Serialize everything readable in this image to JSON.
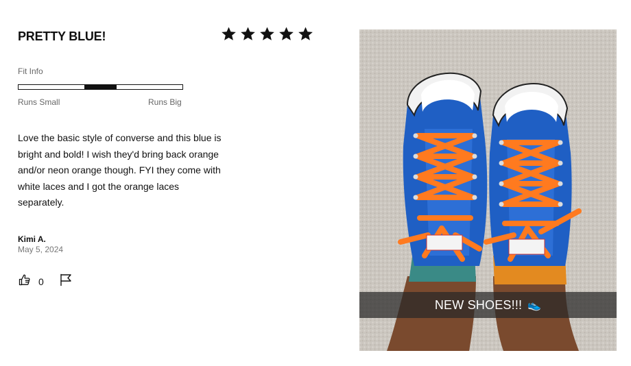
{
  "review": {
    "title": "PRETTY BLUE!",
    "rating": 5,
    "rating_max": 5,
    "fit": {
      "label": "Fit Info",
      "min_label": "Runs Small",
      "max_label": "Runs Big",
      "value": 0.5
    },
    "body": "Love the basic style of converse and this blue is bright and bold! I wish they'd bring back orange and/or neon orange though. FYI they come with white laces and I got the orange laces separately.",
    "author": "Kimi A.",
    "date": "May 5, 2024",
    "helpful_count": "0",
    "icons": {
      "helpful": "thumbs-up-icon",
      "report": "flag-icon",
      "star": "star-icon"
    }
  },
  "photo": {
    "caption": "NEW SHOES!!!",
    "caption_emoji": "👟",
    "colors": {
      "shoe_blue": "#1f5fc4",
      "laces_orange": "#ff7a1f",
      "carpet": "#cfcac4"
    }
  }
}
